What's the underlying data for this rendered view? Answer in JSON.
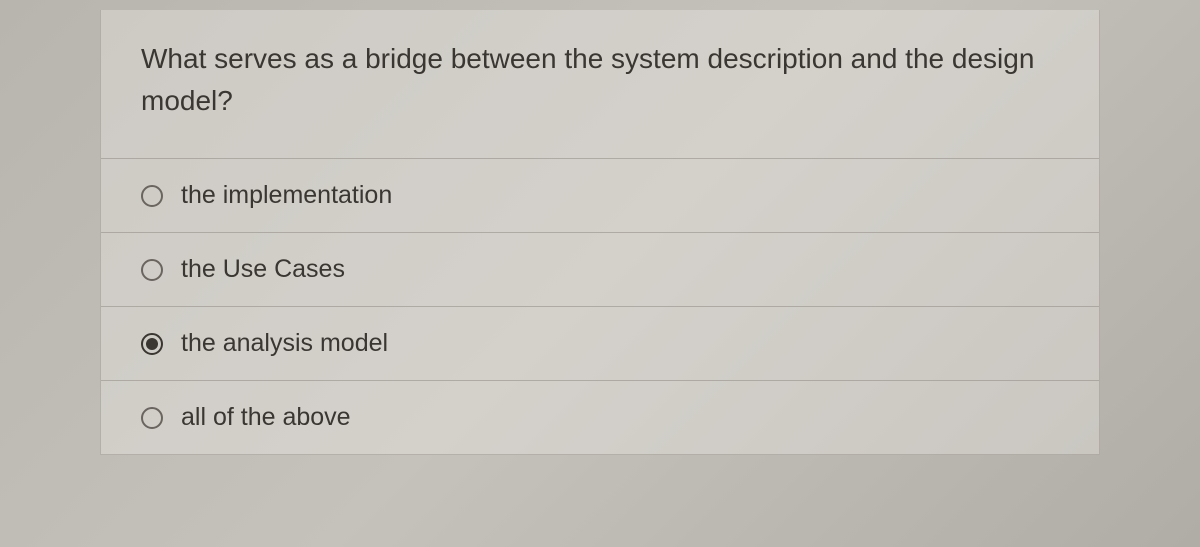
{
  "question": {
    "text": "What serves as a bridge between the system description and the design model?"
  },
  "options": [
    {
      "label": "the implementation",
      "selected": false
    },
    {
      "label": "the Use Cases",
      "selected": false
    },
    {
      "label": "the analysis model",
      "selected": true
    },
    {
      "label": "all of the above",
      "selected": false
    }
  ]
}
